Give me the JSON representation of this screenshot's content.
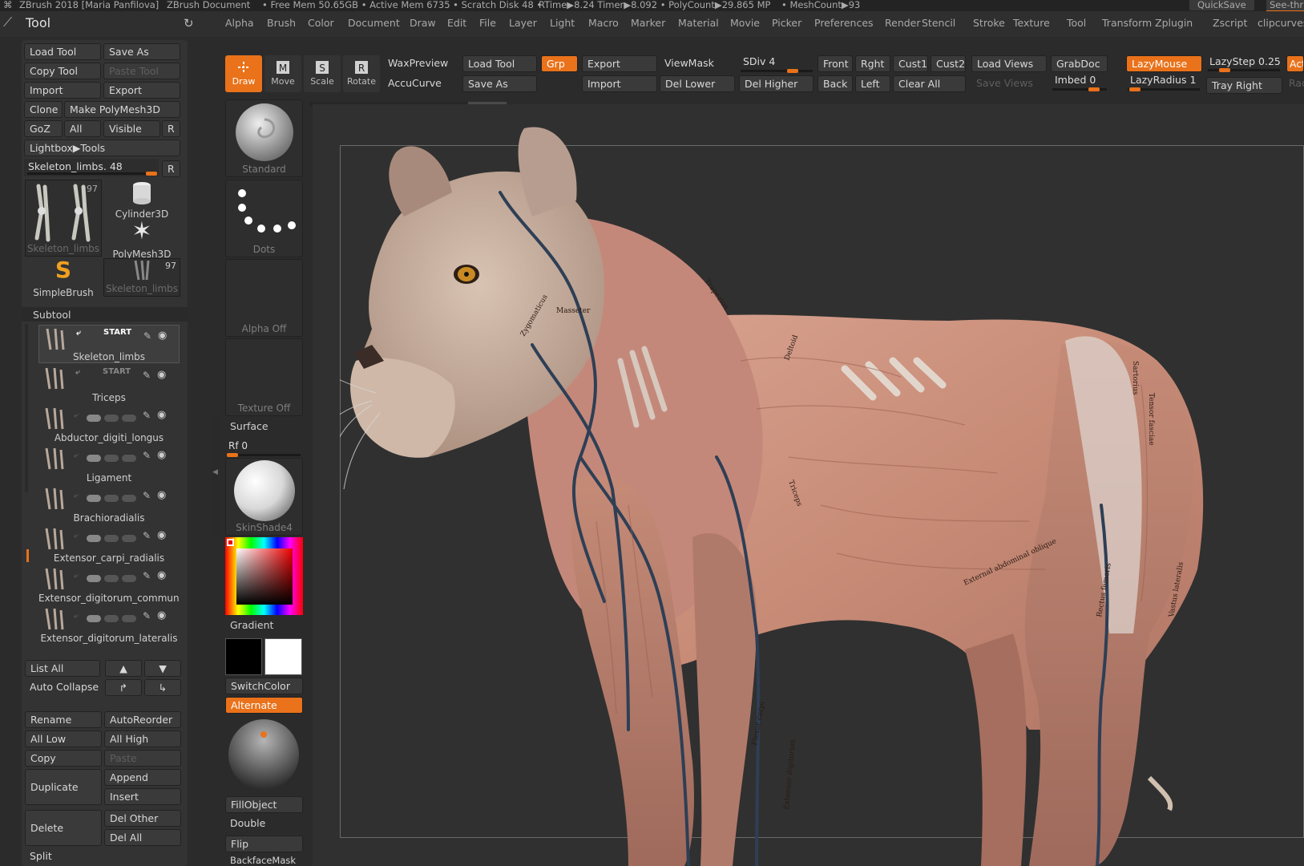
{
  "titlebar": {
    "app": "ZBrush 2018 [Maria Panfilova]",
    "doc": "ZBrush Document",
    "stats": "• Free Mem 50.65GB • Active Mem 6735 • Scratch Disk 48 •",
    "rtime": "RTime▶8.24 Timer▶8.092 • PolyCount▶29.865 MP",
    "mesh": "• MeshCount▶93",
    "quicksave": "QuickSave",
    "seethrough": "See-thr"
  },
  "menu": [
    "Alpha",
    "Brush",
    "Color",
    "Document",
    "Draw",
    "Edit",
    "File",
    "Layer",
    "Light",
    "Macro",
    "Marker",
    "Material",
    "Movie",
    "Picker",
    "Preferences",
    "Render",
    "Stencil",
    "Stroke",
    "Texture",
    "Tool",
    "Transform",
    "Zplugin",
    "Zscript",
    "clipcurves"
  ],
  "tool_panel": {
    "title": "Tool",
    "load_tool": "Load Tool",
    "save_as": "Save As",
    "copy_tool": "Copy Tool",
    "paste_tool": "Paste Tool",
    "import": "Import",
    "export": "Export",
    "clone": "Clone",
    "make_polymesh": "Make PolyMesh3D",
    "goz": "GoZ",
    "all": "All",
    "visible": "Visible",
    "r": "R",
    "lightbox": "Lightbox▶Tools",
    "skeleton_slider": "Skeleton_limbs. 48",
    "tools": [
      {
        "name": "Skeleton_limbs",
        "count": "97"
      },
      {
        "name": "Cylinder3D"
      },
      {
        "name": "PolyMesh3D"
      },
      {
        "name": "SimpleBrush"
      },
      {
        "name": "Skeleton_limbs",
        "count": "97"
      }
    ]
  },
  "subtool": {
    "title": "Subtool",
    "start": "START",
    "items": [
      "Skeleton_limbs",
      "Triceps",
      "Abductor_digiti_longus",
      "Ligament",
      "Brachioradialis",
      "Extensor_carpi_radialis",
      "Extensor_digitorum_communis",
      "Extensor_digitorum_lateralis"
    ],
    "list_all": "List All",
    "auto_collapse": "Auto Collapse",
    "rename": "Rename",
    "autoreorder": "AutoReorder",
    "all_low": "All Low",
    "all_high": "All High",
    "copy": "Copy",
    "paste": "Paste",
    "duplicate": "Duplicate",
    "append": "Append",
    "insert": "Insert",
    "delete": "Delete",
    "del_other": "Del Other",
    "del_all": "Del All",
    "split": "Split"
  },
  "shelf": {
    "draw": "Draw",
    "move": "Move",
    "scale": "Scale",
    "rotate": "Rotate",
    "waxpreview": "WaxPreview",
    "accucurve": "AccuCurve",
    "load_tool": "Load Tool",
    "save_as": "Save As",
    "grp": "Grp",
    "export": "Export",
    "import": "Import",
    "viewmask": "ViewMask",
    "del_lower": "Del Lower",
    "sdiv": "SDiv 4",
    "del_higher": "Del Higher",
    "front": "Front",
    "back": "Back",
    "rght": "Rght",
    "left": "Left",
    "cust1": "Cust1",
    "cust2": "Cust2",
    "clear_all": "Clear All",
    "load_views": "Load Views",
    "save_views": "Save Views",
    "grabdoc": "GrabDoc",
    "imbed": "Imbed 0",
    "lazymouse": "LazyMouse",
    "lazyradius": "LazyRadius 1",
    "lazystep": "LazyStep 0.25",
    "tray_right": "Tray Right",
    "act": "Acti",
    "rad": "Rad"
  },
  "palette": {
    "brush": "Standard",
    "stroke": "Dots",
    "alpha": "Alpha Off",
    "texture": "Texture Off",
    "surface": "Surface",
    "rf": "Rf 0",
    "material": "SkinShade4",
    "gradient": "Gradient",
    "switchcolor": "SwitchColor",
    "alternate": "Alternate",
    "fillobject": "FillObject",
    "double": "Double",
    "flip": "Flip",
    "backfacemask": "BackfaceMask"
  },
  "colors": {
    "accent": "#e9721a",
    "muscle": "#c98e7a",
    "vein": "#2e3f55",
    "bone": "#d8d6cc"
  },
  "canvas_labels": [
    "Trapezius",
    "Deltoid",
    "Triceps",
    "Sartorius",
    "Tensor fasciae",
    "Rectus femoris",
    "Vastus lateralis",
    "External abdominal oblique",
    "Flexor carpi",
    "Extensor digitorum",
    "Masseter",
    "Zygomaticus"
  ]
}
